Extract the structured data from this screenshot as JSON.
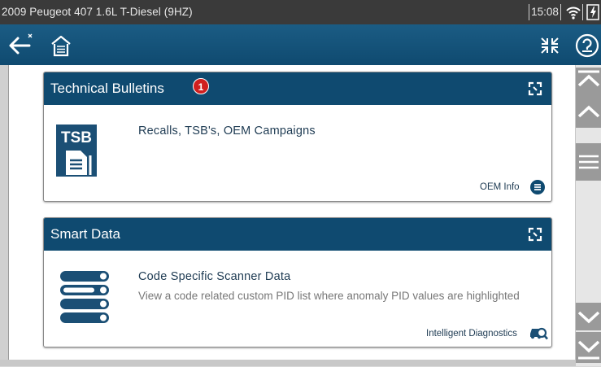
{
  "statusbar": {
    "title": "2009 Peugeot 407 1.6L T-Diesel (9HZ)",
    "time": "15:08",
    "icons": [
      "wifi-icon",
      "battery-icon"
    ]
  },
  "toolbar": {
    "icons": [
      "back-icon",
      "home-icon",
      "collapse-icon",
      "help-icon"
    ]
  },
  "cards": [
    {
      "title": "Technical Bulletins",
      "badge": "1",
      "icon": "tsb-document-icon",
      "icon_label": "TSB",
      "item_title": "Recalls, TSB's, OEM Campaigns",
      "item_desc": "",
      "footer_link": "OEM Info",
      "footer_icon": "list-circle-icon"
    },
    {
      "title": "Smart Data",
      "badge": "",
      "icon": "data-list-icon",
      "item_title": "Code Specific Scanner Data",
      "item_desc": "View a code related custom PID list where anomaly PID values are highlighted",
      "footer_link": "Intelligent Diagnostics",
      "footer_icon": "car-search-icon"
    }
  ],
  "scrollbar": {
    "icons": [
      "scroll-top-icon",
      "scroll-up-icon",
      "scroll-thumb-icon",
      "scroll-down-icon",
      "scroll-bottom-icon"
    ]
  },
  "colors": {
    "header_blue": "#0f4a70",
    "badge_red": "#d01f1f",
    "status_bar": "#3a3a3a"
  }
}
